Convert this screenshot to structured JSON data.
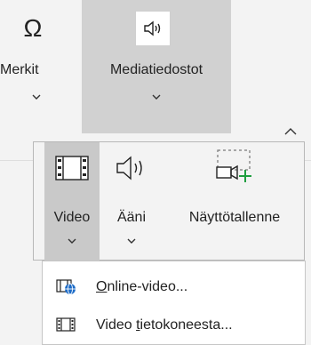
{
  "ribbon": {
    "merkit_label": "Merkit",
    "media_label": "Mediatiedostot"
  },
  "popup": {
    "video_label": "Video",
    "audio_label": "Ääni",
    "screen_label": "Näyttötallenne"
  },
  "menu": {
    "online_prefix": "O",
    "online_rest": "nline-video...",
    "computer_prefix": "Video ",
    "computer_underlined": "t",
    "computer_rest": "ietokoneesta..."
  },
  "colors": {
    "ribbon_bg": "#f3f3f3",
    "selected_bg": "#d1d1d1",
    "green_plus": "#1f9e3f",
    "blue_globe": "#1e6cc7"
  }
}
